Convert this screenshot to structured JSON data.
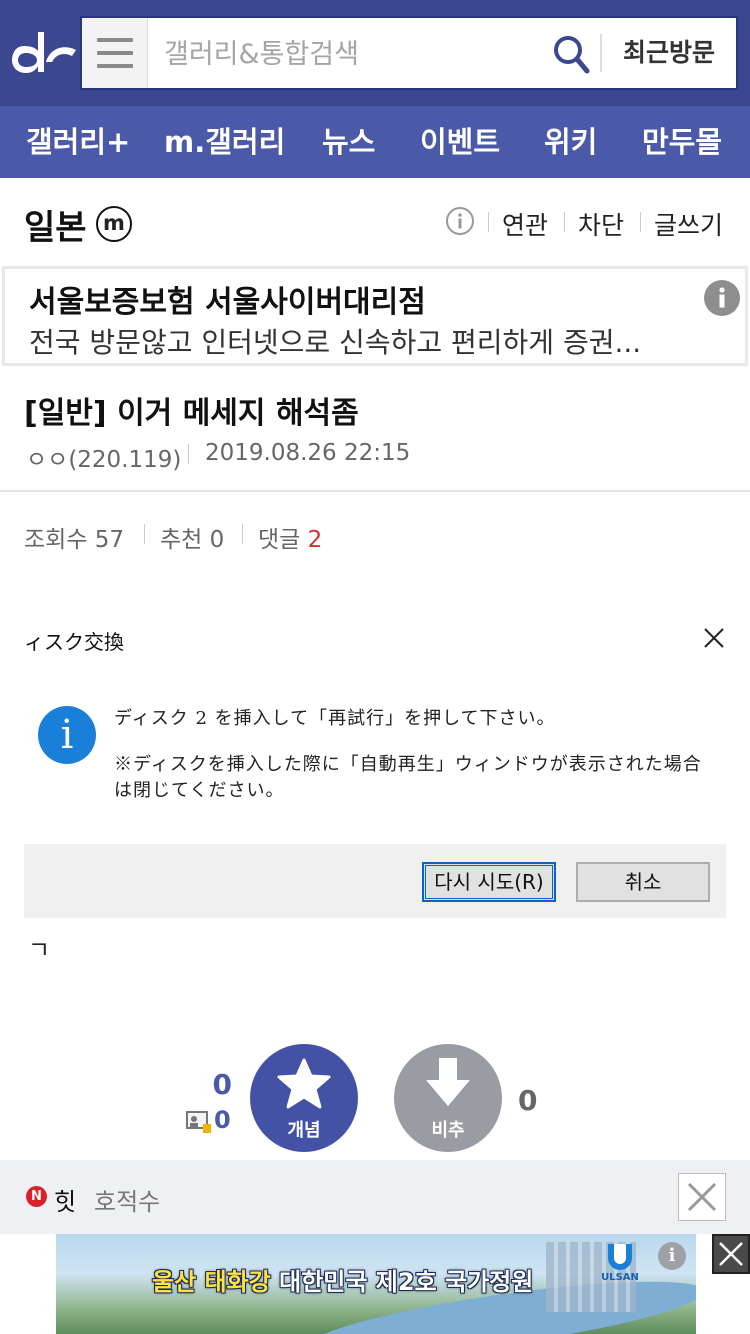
{
  "header": {
    "search_placeholder": "갤러리&통합검색",
    "recent_label": "최근방문"
  },
  "nav": {
    "items": [
      "갤러리+",
      "m.갤러리",
      "뉴스",
      "이벤트",
      "위키",
      "만두몰"
    ]
  },
  "gallery": {
    "title": "일본",
    "badge": "m",
    "links": [
      "연관",
      "차단",
      "글쓰기"
    ]
  },
  "ad": {
    "title": "서울보증보험 서울사이버대리점",
    "desc": "전국 방문않고 인터넷으로 신속하고 편리하게 증권..."
  },
  "post": {
    "title": "[일반] 이거 메세지 해석좀",
    "author": "ㅇㅇ(220.119)",
    "date": "2019.08.26 22:15",
    "views_label": "조회수",
    "views": "57",
    "rec_label": "추천",
    "rec": "0",
    "comments_label": "댓글",
    "comments": "2",
    "body_text": "ㄱ"
  },
  "dialog": {
    "title": "ィスク交換",
    "message1": "ディスク 2 を挿入して「再試行」を押して下さい。",
    "message2": "※ディスクを挿入した際に「自動再生」ウィンドウが表示された場合は閉じてください。",
    "icon": "i",
    "retry_label": "다시 시도(R)",
    "cancel_label": "취소"
  },
  "vote": {
    "up_count": "0",
    "fix_count": "0",
    "up_label": "개념",
    "down_label": "비추",
    "down_count": "0"
  },
  "hit": {
    "badge": "N",
    "label": "힛",
    "text": "호적수"
  },
  "banner": {
    "text_highlight": "울산 태화강",
    "text_rest": " 대한민국 제2호 국가정원",
    "logo_text": "ULSAN",
    "info": "i"
  },
  "colors": {
    "header_bg": "#3b4890",
    "nav_bg": "#4b5aa8",
    "accent": "#4452a6",
    "comment_count": "#d32f2f"
  }
}
